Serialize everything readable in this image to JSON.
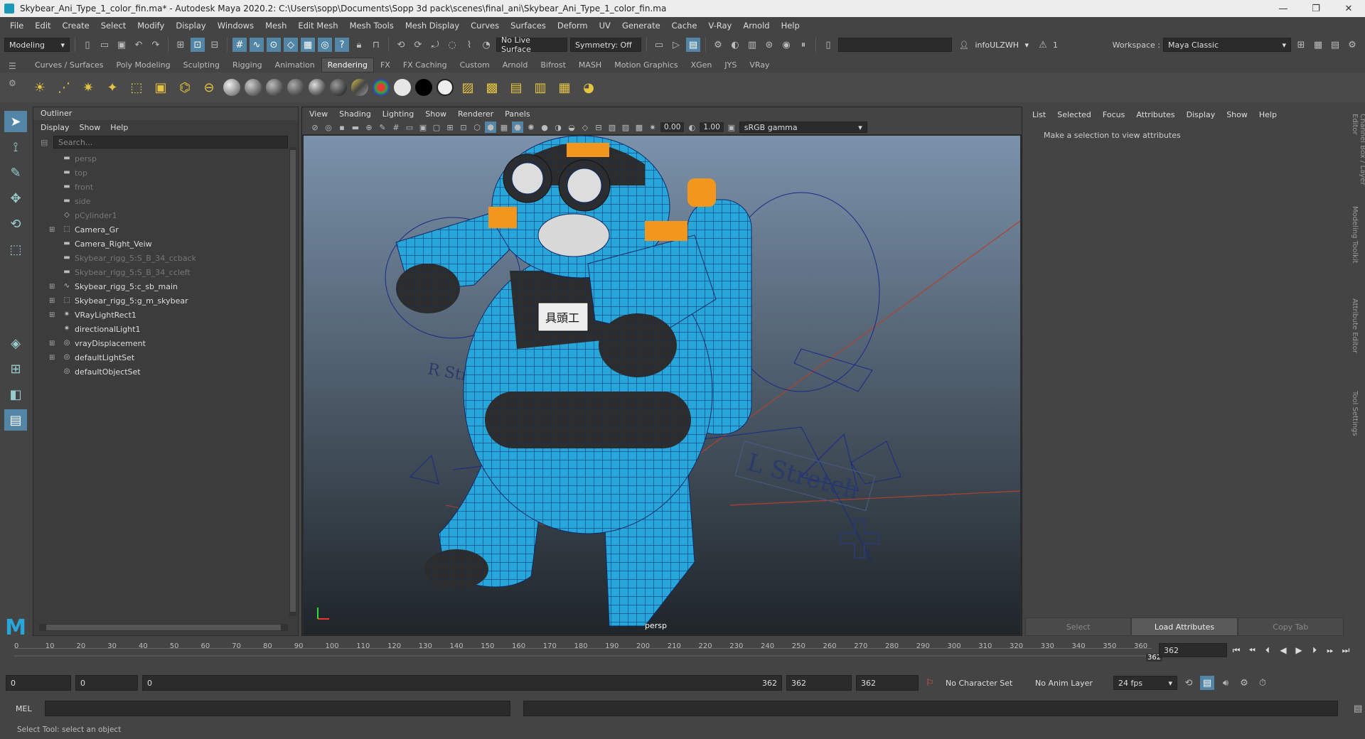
{
  "window": {
    "title": "Skybear_Ani_Type_1_color_fin.ma* - Autodesk Maya 2020.2: C:\\Users\\sopp\\Documents\\Sopp 3d pack\\scenes\\final_ani\\Skybear_Ani_Type_1_color_fin.ma",
    "min": "—",
    "max": "❐",
    "close": "✕"
  },
  "menubar": [
    "File",
    "Edit",
    "Create",
    "Select",
    "Modify",
    "Display",
    "Windows",
    "Mesh",
    "Edit Mesh",
    "Mesh Tools",
    "Mesh Display",
    "Curves",
    "Surfaces",
    "Deform",
    "UV",
    "Generate",
    "Cache",
    "V-Ray",
    "Arnold",
    "Help"
  ],
  "status": {
    "mode": "Modeling",
    "live_surface": "No Live Surface",
    "symmetry": "Symmetry: Off",
    "workspace_label": "Workspace :",
    "workspace": "Maya Classic",
    "user": "infoULZWH",
    "warn_count": "1"
  },
  "shelf_tabs": [
    "Curves / Surfaces",
    "Poly Modeling",
    "Sculpting",
    "Rigging",
    "Animation",
    "Rendering",
    "FX",
    "FX Caching",
    "Custom",
    "Arnold",
    "Bifrost",
    "MASH",
    "Motion Graphics",
    "XGen",
    "JYS",
    "VRay"
  ],
  "shelf_active": "Rendering",
  "outliner": {
    "title": "Outliner",
    "menu": [
      "Display",
      "Show",
      "Help"
    ],
    "search_placeholder": "Search...",
    "items": [
      {
        "label": "persp",
        "dim": true,
        "exp": false,
        "icon": "camera-icon"
      },
      {
        "label": "top",
        "dim": true,
        "exp": false,
        "icon": "camera-icon"
      },
      {
        "label": "front",
        "dim": true,
        "exp": false,
        "icon": "camera-icon"
      },
      {
        "label": "side",
        "dim": true,
        "exp": false,
        "icon": "camera-icon"
      },
      {
        "label": "pCylinder1",
        "dim": true,
        "exp": false,
        "icon": "mesh-icon"
      },
      {
        "label": "Camera_Gr",
        "dim": false,
        "exp": true,
        "icon": "group-icon"
      },
      {
        "label": "Camera_Right_Veiw",
        "dim": false,
        "exp": false,
        "icon": "camera-icon"
      },
      {
        "label": "Skybear_rigg_5:S_B_34_ccback",
        "dim": true,
        "exp": false,
        "icon": "camera-icon"
      },
      {
        "label": "Skybear_rigg_5:S_B_34_ccleft",
        "dim": true,
        "exp": false,
        "icon": "camera-icon"
      },
      {
        "label": "Skybear_rigg_5:c_sb_main",
        "dim": false,
        "exp": true,
        "icon": "curve-icon"
      },
      {
        "label": "Skybear_rigg_5:g_m_skybear",
        "dim": false,
        "exp": true,
        "icon": "group-icon"
      },
      {
        "label": "VRayLightRect1",
        "dim": false,
        "exp": true,
        "icon": "light-icon"
      },
      {
        "label": "directionalLight1",
        "dim": false,
        "exp": false,
        "icon": "light-icon"
      },
      {
        "label": "vrayDisplacement",
        "dim": false,
        "exp": true,
        "icon": "set-icon"
      },
      {
        "label": "defaultLightSet",
        "dim": false,
        "exp": true,
        "icon": "set-icon"
      },
      {
        "label": "defaultObjectSet",
        "dim": false,
        "exp": false,
        "icon": "set-icon"
      }
    ]
  },
  "viewport": {
    "menu": [
      "View",
      "Shading",
      "Lighting",
      "Show",
      "Renderer",
      "Panels"
    ],
    "exposure": "0.00",
    "gamma": "1.00",
    "colorspace": "sRGB gamma",
    "camera": "persp",
    "labels": {
      "r_stretch": "R Stretch",
      "l_stretch": "L Stretch",
      "badge": "具頭工"
    },
    "colors": {
      "mesh": "#29a6d9",
      "wire": "#0c2a6b",
      "accent": "#f2961e",
      "dark": "#2d2d2d"
    }
  },
  "attr": {
    "menu": [
      "List",
      "Selected",
      "Focus",
      "Attributes",
      "Display",
      "Show",
      "Help"
    ],
    "message": "Make a selection to view attributes",
    "buttons": [
      "Select",
      "Load Attributes",
      "Copy Tab"
    ]
  },
  "side_tabs": [
    "Channel Box / Layer Editor",
    "Modeling Toolkit",
    "Attribute Editor",
    "Tool Settings"
  ],
  "timeline": {
    "ticks": [
      "0",
      "10",
      "20",
      "30",
      "40",
      "50",
      "60",
      "70",
      "80",
      "90",
      "100",
      "110",
      "120",
      "130",
      "140",
      "150",
      "160",
      "170",
      "180",
      "190",
      "200",
      "210",
      "220",
      "230",
      "240",
      "250",
      "260",
      "270",
      "280",
      "290",
      "300",
      "310",
      "320",
      "330",
      "340",
      "350",
      "360"
    ],
    "current": "362",
    "end_marker": "362"
  },
  "range": {
    "start": "0",
    "anim_start": "0",
    "slider_start": "0",
    "slider_end": "362",
    "anim_end": "362",
    "end": "362",
    "character_set": "No Character Set",
    "anim_layer": "No Anim Layer",
    "fps": "24 fps"
  },
  "mel": {
    "label": "MEL"
  },
  "help_line": "Select Tool: select an object"
}
